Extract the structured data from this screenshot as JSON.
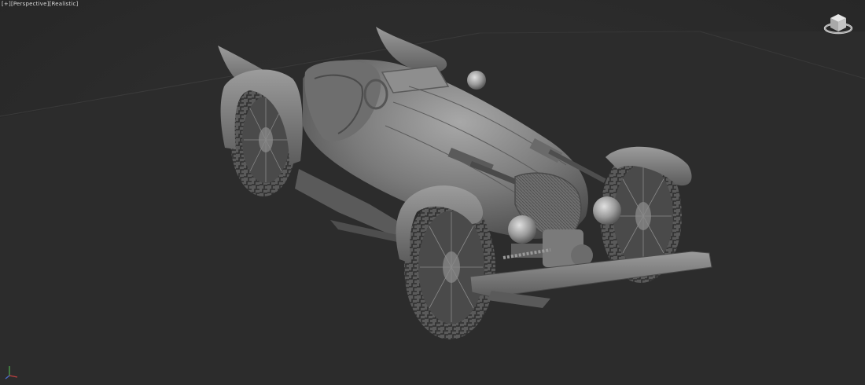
{
  "viewport": {
    "label": {
      "plus": "[+]",
      "view": "[Perspective]",
      "shading": "[Realistic]"
    }
  },
  "icons": {
    "viewcube": "viewcube-icon",
    "axis": "axis-tripod-icon"
  },
  "colors": {
    "background": "#2b2b2b",
    "grid": "#3a3a3a",
    "model": "#8a8a8a",
    "model_dark": "#4a4a4a",
    "model_light": "#b0b0b0"
  }
}
